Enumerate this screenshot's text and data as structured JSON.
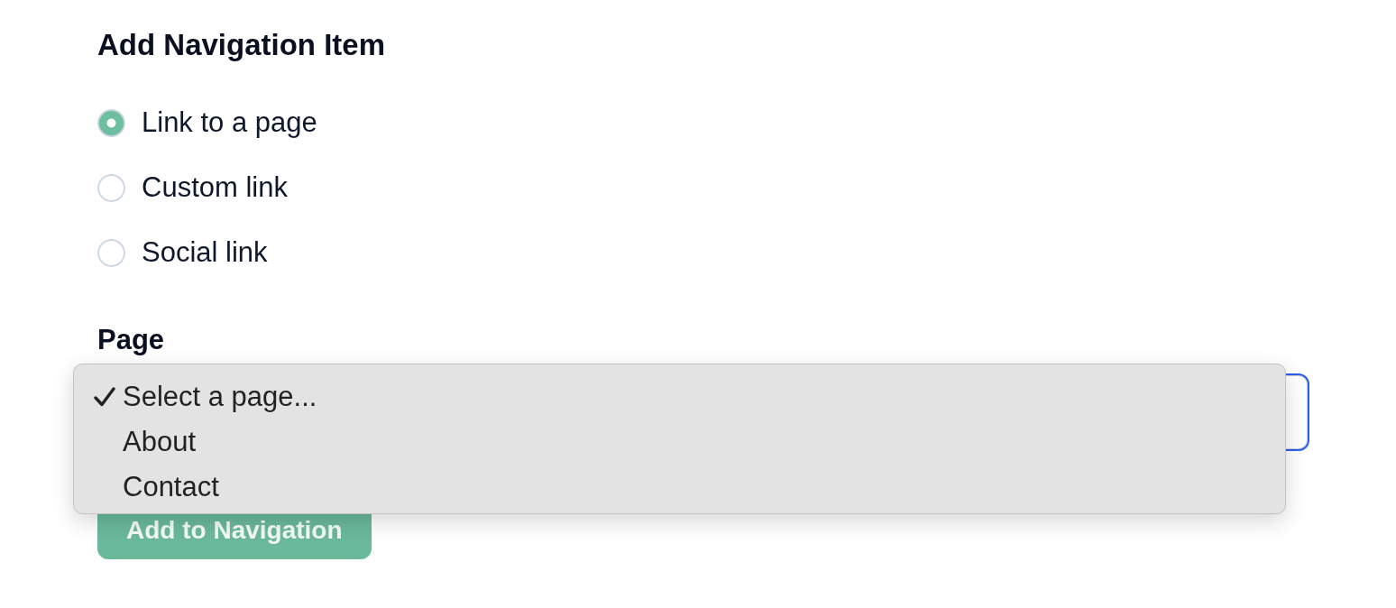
{
  "heading": "Add Navigation Item",
  "link_types": [
    {
      "label": "Link to a page",
      "selected": true
    },
    {
      "label": "Custom link",
      "selected": false
    },
    {
      "label": "Social link",
      "selected": false
    }
  ],
  "page_field": {
    "label": "Page",
    "focused": true,
    "options": [
      {
        "label": "Select a page...",
        "selected": true
      },
      {
        "label": "About",
        "selected": false
      },
      {
        "label": "Contact",
        "selected": false
      }
    ]
  },
  "submit_button": {
    "label": "Add to Navigation"
  }
}
